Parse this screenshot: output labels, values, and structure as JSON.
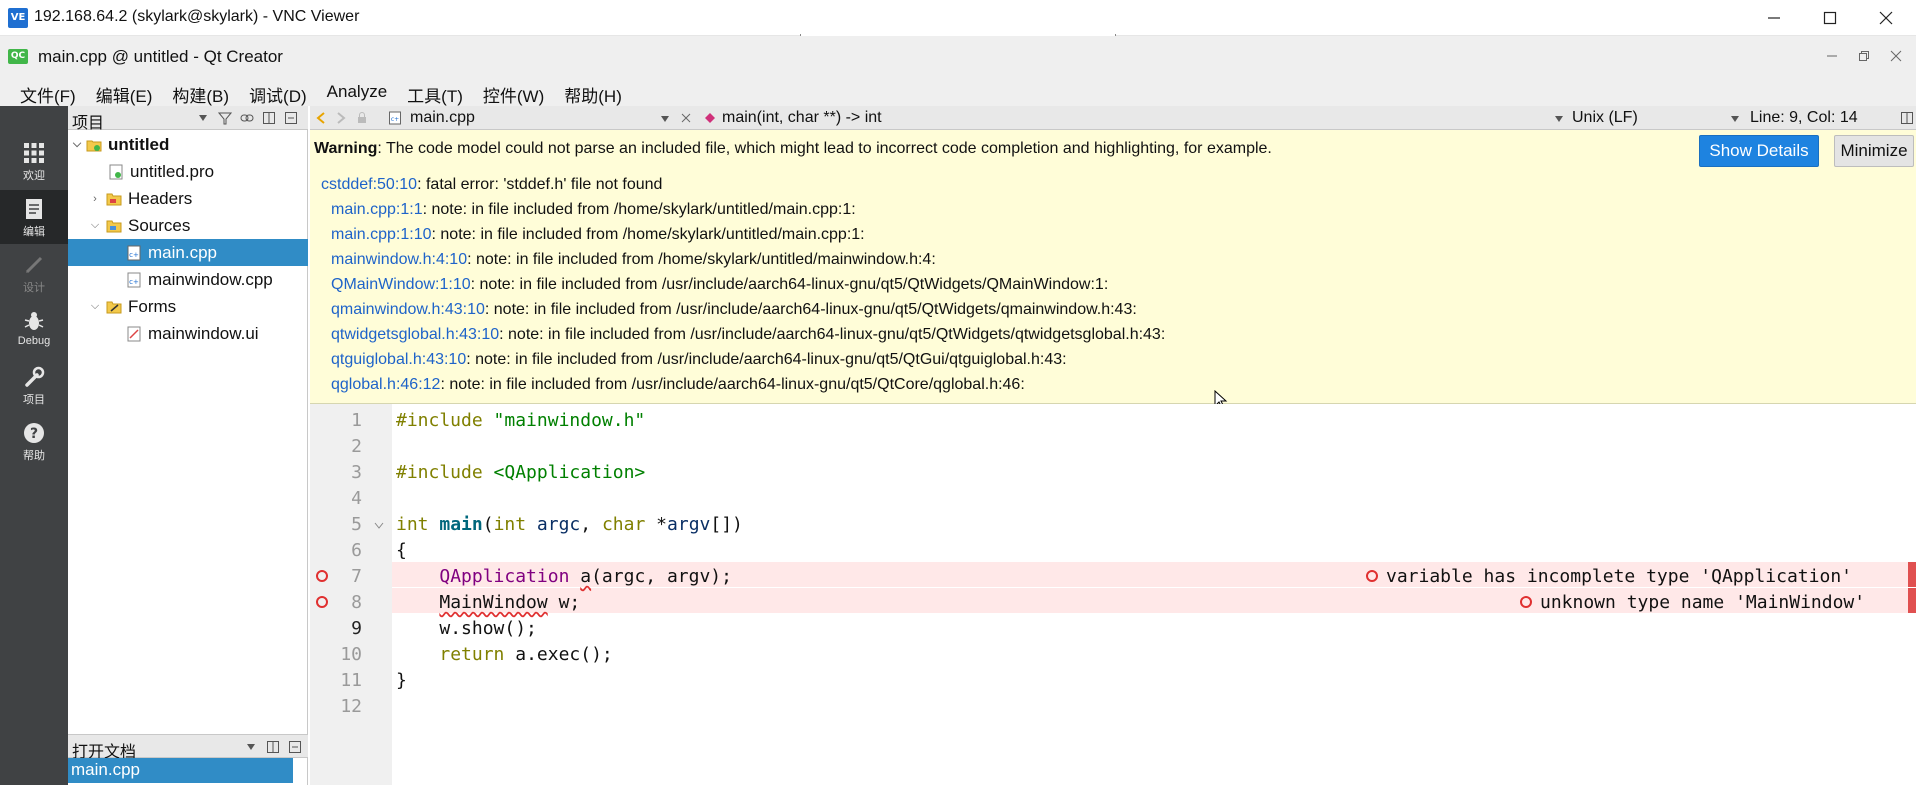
{
  "vnc": {
    "logo": "VE",
    "title": "192.168.64.2 (skylark@skylark) - VNC Viewer"
  },
  "qt": {
    "logo": "QC",
    "title": "main.cpp @ untitled - Qt Creator"
  },
  "menu": [
    "文件(F)",
    "编辑(E)",
    "构建(B)",
    "调试(D)",
    "Analyze",
    "工具(T)",
    "控件(W)",
    "帮助(H)"
  ],
  "modes": [
    {
      "label": "欢迎"
    },
    {
      "label": "编辑"
    },
    {
      "label": "设计"
    },
    {
      "label": "Debug"
    },
    {
      "label": "项目"
    },
    {
      "label": "帮助"
    }
  ],
  "project_panel": {
    "title": "项目",
    "tree": [
      {
        "label": "untitled"
      },
      {
        "label": "untitled.pro"
      },
      {
        "label": "Headers"
      },
      {
        "label": "Sources"
      },
      {
        "label": "main.cpp"
      },
      {
        "label": "mainwindow.cpp"
      },
      {
        "label": "Forms"
      },
      {
        "label": "mainwindow.ui"
      }
    ]
  },
  "open_docs": {
    "title": "打开文档",
    "items": [
      "main.cpp"
    ]
  },
  "editor_toolbar": {
    "file": "main.cpp",
    "symbol": "main(int, char **) -> int",
    "line_ending": "Unix (LF)",
    "position": "Line: 9, Col: 14"
  },
  "info_bar": {
    "warning_label": "Warning",
    "warning_text": ": The code model could not parse an included file, which might lead to incorrect code completion and highlighting, for example.",
    "show_details": "Show Details",
    "minimize": "Minimize",
    "diagnostics": [
      {
        "link": "cstddef:50:10",
        "text": ": fatal error: 'stddef.h' file not found"
      },
      {
        "link": "main.cpp:1:1",
        "text": ": note: in file included from /home/skylark/untitled/main.cpp:1:"
      },
      {
        "link": "main.cpp:1:10",
        "text": ": note: in file included from /home/skylark/untitled/main.cpp:1:"
      },
      {
        "link": "mainwindow.h:4:10",
        "text": ": note: in file included from /home/skylark/untitled/mainwindow.h:4:"
      },
      {
        "link": "QMainWindow:1:10",
        "text": ": note: in file included from /usr/include/aarch64-linux-gnu/qt5/QtWidgets/QMainWindow:1:"
      },
      {
        "link": "qmainwindow.h:43:10",
        "text": ": note: in file included from /usr/include/aarch64-linux-gnu/qt5/QtWidgets/qmainwindow.h:43:"
      },
      {
        "link": "qtwidgetsglobal.h:43:10",
        "text": ": note: in file included from /usr/include/aarch64-linux-gnu/qt5/QtWidgets/qtwidgetsglobal.h:43:"
      },
      {
        "link": "qtguiglobal.h:43:10",
        "text": ": note: in file included from /usr/include/aarch64-linux-gnu/qt5/QtGui/qtguiglobal.h:43:"
      },
      {
        "link": "qglobal.h:46:12",
        "text": ": note: in file included from /usr/include/aarch64-linux-gnu/qt5/QtCore/qglobal.h:46:"
      }
    ]
  },
  "code": {
    "line_numbers": [
      "1",
      "2",
      "3",
      "4",
      "5",
      "6",
      "7",
      "8",
      "9",
      "10",
      "11",
      "12"
    ],
    "l1": {
      "directive": "#include",
      "path": "\"mainwindow.h\""
    },
    "l3": {
      "directive": "#include",
      "path": "<QApplication>"
    },
    "l5": {
      "int1": "int",
      "main": "main",
      "int2": "int",
      "argc": "argc",
      "char": "char",
      "star": "*",
      "argv": "argv",
      "open": "(",
      "comma": ", ",
      "close": "[])"
    },
    "l6": "{",
    "l7": {
      "type": "QApplication",
      "var": "a",
      "rest": "(argc, argv);"
    },
    "l8": {
      "type": "MainWindow",
      "rest": " w;"
    },
    "l9": "w.show();",
    "l10": {
      "kw": "return",
      "rest": " a.exec();"
    },
    "l11": "}",
    "errors": [
      "variable has incomplete type 'QApplication'",
      "unknown type name 'MainWindow'"
    ]
  }
}
